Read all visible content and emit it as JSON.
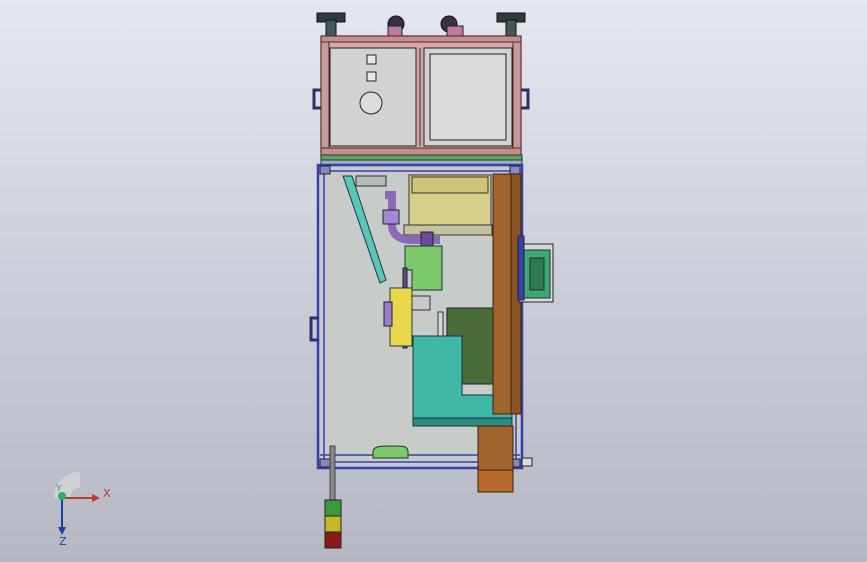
{
  "triad": {
    "x_label": "X",
    "y_label": "Y",
    "z_label": "Z",
    "x_color": "#c0392b",
    "y_color": "#27ae60",
    "z_color": "#1f3fa8"
  },
  "colors": {
    "background_top": "#e4e7ee",
    "background_bottom": "#b5b8c3",
    "frame_blue": "#3a3fb0",
    "cabinet_pink": "#d8a8a8",
    "panel_gray": "#d2d2d2",
    "yellow_part": "#d8d08a",
    "teal_part": "#3fb8a8",
    "dark_green_part": "#4a6b3a",
    "brown_part": "#a0652e",
    "violet_part": "#8a6ab8",
    "green_part": "#6cc05a"
  },
  "icons": {
    "triad": "coordinate-triad-icon",
    "stack_light": "stack-light-icon"
  }
}
